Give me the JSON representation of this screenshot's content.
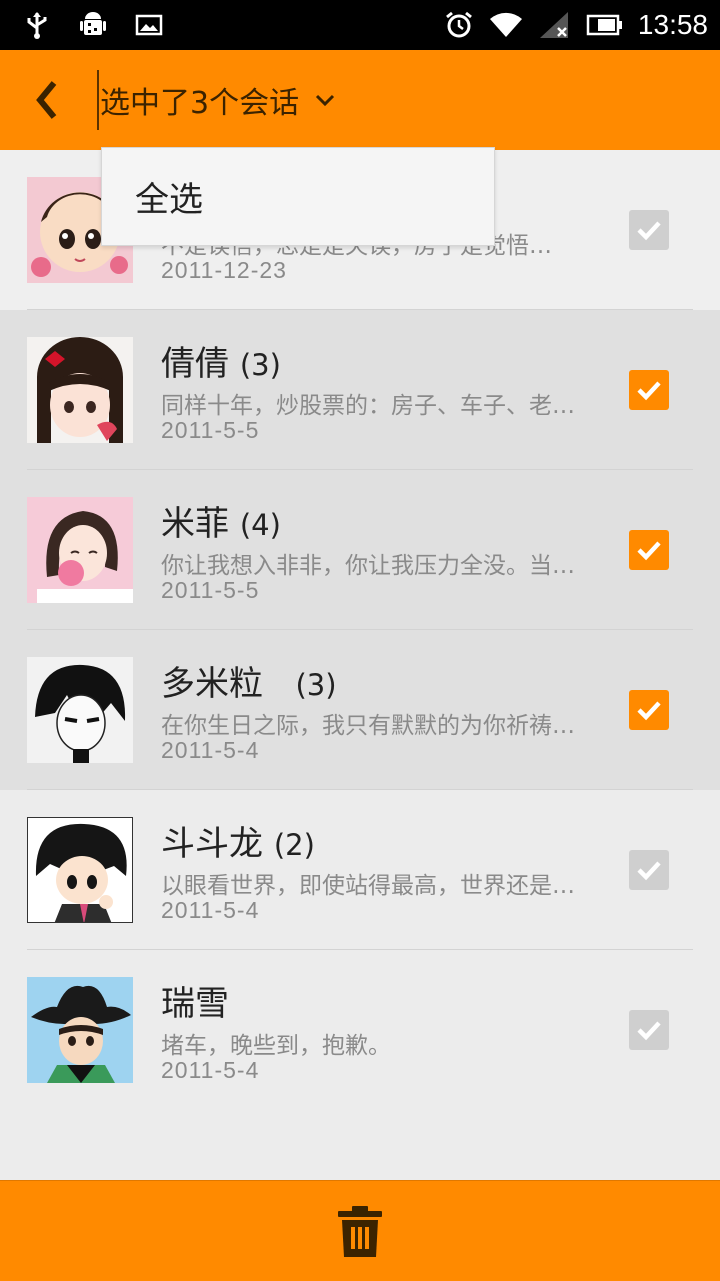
{
  "status_bar": {
    "time": "13:58",
    "left_icons": [
      "usb-icon",
      "android-debug-icon",
      "image-icon"
    ],
    "right_icons": [
      "alarm-icon",
      "wifi-icon",
      "signal-icon",
      "battery-icon"
    ]
  },
  "action_bar": {
    "title": "选中了3个会话",
    "back_icon": "chevron-left-icon",
    "dropdown_icon": "chevron-down-icon",
    "accent_color": "#ff8a00"
  },
  "dropdown_menu": {
    "items": [
      "全选"
    ]
  },
  "conversations": [
    {
      "name": "",
      "count": "",
      "preview": "不是误信，忘是是失误，房子是觉悟…",
      "date": "2011-12-23",
      "selected": false
    },
    {
      "name": "倩倩",
      "count": "(3)",
      "preview": "同样十年，炒股票的：房子、车子、老婆…",
      "date": "2011-5-5",
      "selected": true
    },
    {
      "name": "米菲",
      "count": "(4)",
      "preview": "你让我想入非非，你让我压力全没。当你…",
      "date": "2011-5-5",
      "selected": true
    },
    {
      "name": "多米粒  ",
      "count": "(3)",
      "preview": "在你生日之际，我只有默默的为你祈祷…",
      "date": "2011-5-4",
      "selected": true
    },
    {
      "name": "斗斗龙",
      "count": "(2)",
      "preview": "以眼看世界，即使站得最高，世界还是那…",
      "date": "2011-5-4",
      "selected": false
    },
    {
      "name": "瑞雪",
      "count": "",
      "preview": "堵车，晚些到，抱歉。",
      "date": "2011-5-4",
      "selected": false
    }
  ],
  "bottom_bar": {
    "delete_icon": "trash-icon"
  }
}
